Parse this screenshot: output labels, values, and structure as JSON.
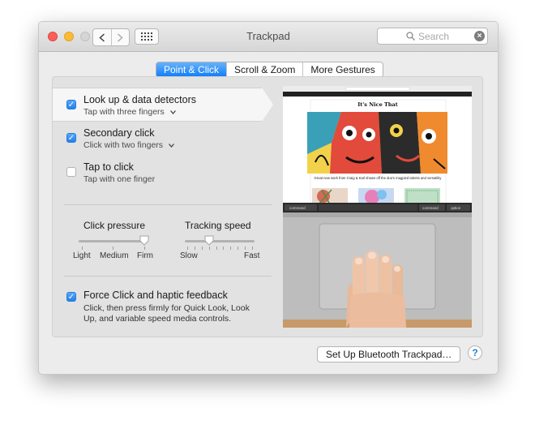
{
  "window": {
    "title": "Trackpad"
  },
  "toolbar": {
    "back_icon": "chevron-left-icon",
    "forward_icon": "chevron-right-icon",
    "show_all_icon": "grid-icon"
  },
  "search": {
    "placeholder": "Search"
  },
  "tabs": [
    {
      "label": "Point & Click",
      "active": true
    },
    {
      "label": "Scroll & Zoom",
      "active": false
    },
    {
      "label": "More Gestures",
      "active": false
    }
  ],
  "options": [
    {
      "label": "Look up & data detectors",
      "sub": "Tap with three fingers",
      "checked": true,
      "has_menu": true
    },
    {
      "label": "Secondary click",
      "sub": "Click with two fingers",
      "checked": true,
      "has_menu": true
    },
    {
      "label": "Tap to click",
      "sub": "Tap with one finger",
      "checked": false,
      "has_menu": false
    }
  ],
  "click_pressure": {
    "label": "Click pressure",
    "ticks": [
      "Light",
      "Medium",
      "Firm"
    ],
    "value": "Firm"
  },
  "tracking_speed": {
    "label": "Tracking speed",
    "min_label": "Slow",
    "max_label": "Fast",
    "level": 0.35
  },
  "force_click": {
    "label": "Force Click and haptic feedback",
    "desc": "Click, then press firmly for Quick Look, Look Up, and variable speed media controls.",
    "checked": true
  },
  "preview": {
    "site_title": "It's Nice That",
    "caption": "Great new work from Craig & Karl shows off the duo's magpied talents and versatility",
    "keys": [
      "command",
      "command",
      "option"
    ]
  },
  "footer": {
    "setup_label": "Set Up Bluetooth Trackpad…",
    "help_label": "?"
  },
  "colors": {
    "accent": "#1f80ee",
    "window_bg": "#ececec",
    "panel_bg": "#e2e2e2"
  }
}
